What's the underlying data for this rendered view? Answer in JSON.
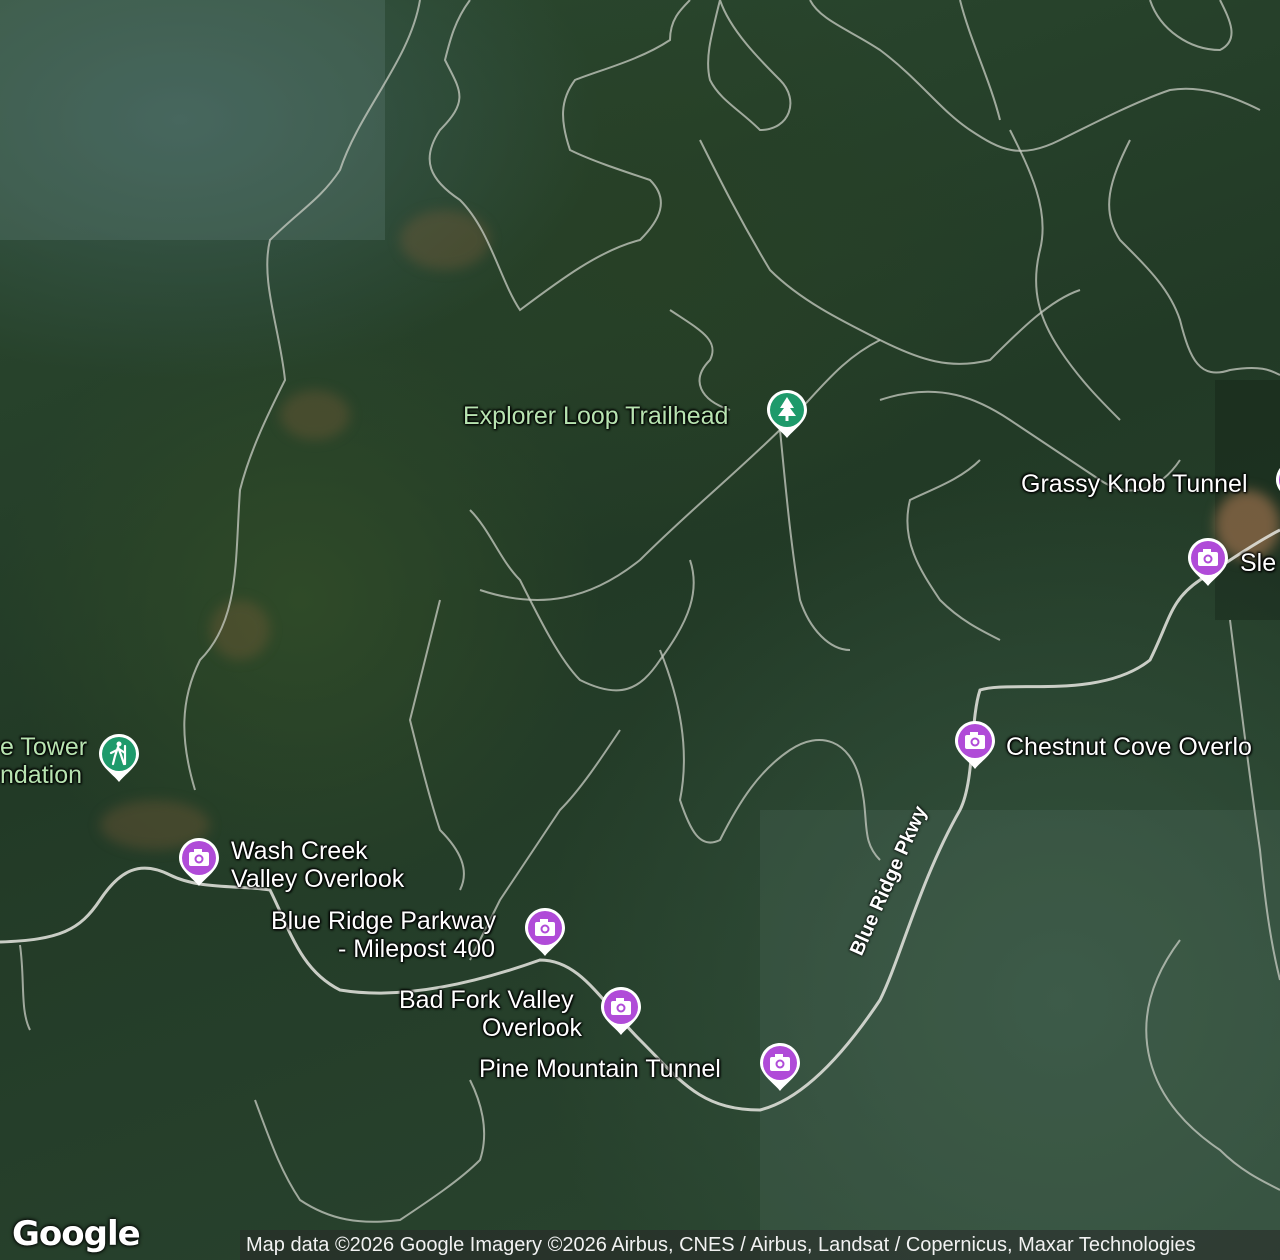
{
  "map": {
    "type": "satellite",
    "road_label": "Blue Ridge Pkwy",
    "brand": "Google",
    "attribution": "Map data ©2026 Google Imagery ©2026 Airbus, CNES / Airbus, Landsat / Copernicus, Maxar Technologies"
  },
  "pois": [
    {
      "label": "Explorer Loop Trailhead",
      "icon": "trailhead-tree-icon",
      "color": "#1e9a6b",
      "label_color": "green"
    },
    {
      "label": "Grassy Knob Tunnel",
      "icon": "camera-icon",
      "color": "#b04bd8",
      "label_color": "white"
    },
    {
      "label": "Sle",
      "icon": "camera-icon",
      "color": "#b04bd8",
      "label_color": "white"
    },
    {
      "label": "Chestnut Cove Overlo",
      "icon": "camera-icon",
      "color": "#b04bd8",
      "label_color": "white"
    },
    {
      "label_line1": "e Tower",
      "label_line2": "ndation",
      "icon": "hiker-icon",
      "color": "#1e9a6b",
      "label_color": "green"
    },
    {
      "label_line1": "Wash Creek",
      "label_line2": "Valley Overlook",
      "icon": "camera-icon",
      "color": "#b04bd8",
      "label_color": "white"
    },
    {
      "label_line1": "Blue Ridge Parkway",
      "label_line2": "- Milepost 400",
      "icon": "camera-icon",
      "color": "#b04bd8",
      "label_color": "white"
    },
    {
      "label_line1": "Bad Fork Valley",
      "label_line2": "Overlook",
      "icon": "camera-icon",
      "color": "#b04bd8",
      "label_color": "white"
    },
    {
      "label": "Pine Mountain Tunnel",
      "icon": "camera-icon",
      "color": "#b04bd8",
      "label_color": "white"
    }
  ]
}
